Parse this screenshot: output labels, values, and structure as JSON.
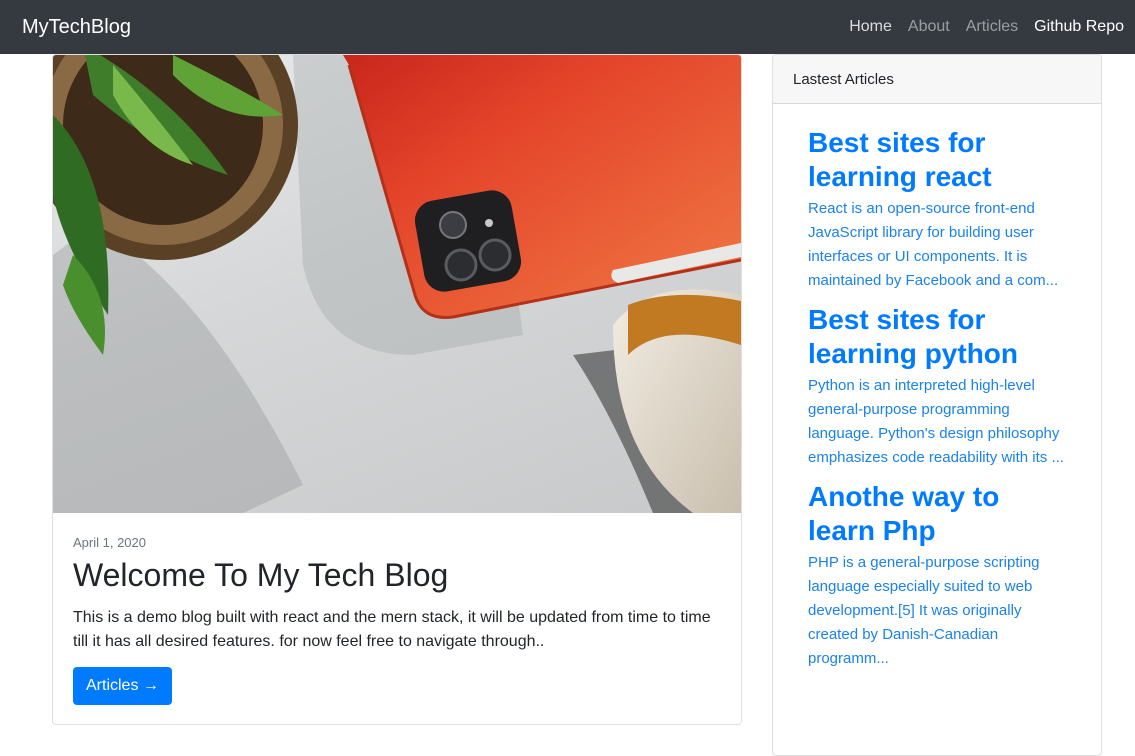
{
  "navbar": {
    "brand": "MyTechBlog",
    "links": [
      {
        "label": "Home"
      },
      {
        "label": "About"
      },
      {
        "label": "Articles"
      },
      {
        "label": "Github Repo"
      }
    ]
  },
  "main_card": {
    "image_alt": "Orange tablet on desk",
    "date": "April 1, 2020",
    "title": "Welcome To My Tech Blog",
    "text": "This is a demo blog built with react and the mern stack, it will be updated from time to time till it has all desired features. for now feel free to navigate through..",
    "button_label": "Articles →"
  },
  "sidebar": {
    "header": "Lastest Articles",
    "articles": [
      {
        "title": "Best sites for learning react",
        "excerpt": "React is an open-source front-end JavaScript library for building user interfaces or UI components. It is maintained by Facebook and a com..."
      },
      {
        "title": "Best sites for learning python",
        "excerpt": "Python is an interpreted high-level general-purpose programming language. Python's design philosophy emphasizes code readability with its ..."
      },
      {
        "title": "Anothe way to learn Php",
        "excerpt": "PHP is a general-purpose scripting language especially suited to web development.[5] It was originally created by Danish-Canadian programm..."
      }
    ]
  },
  "colors": {
    "navbar_bg": "#343a40",
    "primary": "#007bff",
    "tablet_orange": "#ea5a2c"
  }
}
